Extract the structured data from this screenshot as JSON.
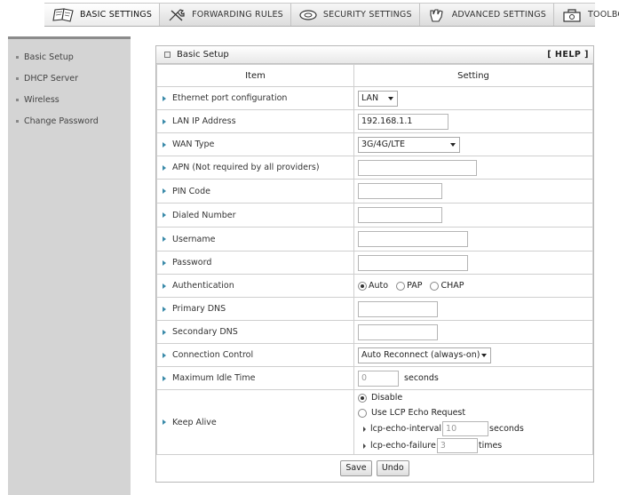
{
  "nav": {
    "tabs": [
      {
        "label": "BASIC SETTINGS",
        "icon": "notebook-icon",
        "active": true
      },
      {
        "label": "FORWARDING RULES",
        "icon": "tools-icon",
        "active": false
      },
      {
        "label": "SECURITY SETTINGS",
        "icon": "disk-icon",
        "active": false
      },
      {
        "label": "ADVANCED SETTINGS",
        "icon": "hand-icon",
        "active": false
      },
      {
        "label": "TOOLBOX",
        "icon": "toolbox-icon",
        "active": false
      }
    ]
  },
  "sidebar": {
    "items": [
      "Basic Setup",
      "DHCP Server",
      "Wireless",
      "Change Password"
    ]
  },
  "panel": {
    "title": "Basic Setup",
    "help": "[ HELP ]",
    "col_item": "Item",
    "col_setting": "Setting"
  },
  "form": {
    "ethernet": {
      "label": "Ethernet port configuration",
      "value": "LAN"
    },
    "lan_ip": {
      "label": "LAN IP Address",
      "value": "192.168.1.1"
    },
    "wan_type": {
      "label": "WAN Type",
      "value": "3G/4G/LTE"
    },
    "apn": {
      "label": "APN (Not required by all providers)",
      "value": ""
    },
    "pin": {
      "label": "PIN Code",
      "value": ""
    },
    "dialed": {
      "label": "Dialed Number",
      "value": ""
    },
    "username": {
      "label": "Username",
      "value": ""
    },
    "password": {
      "label": "Password",
      "value": ""
    },
    "auth": {
      "label": "Authentication",
      "options": [
        "Auto",
        "PAP",
        "CHAP"
      ],
      "selected": "Auto"
    },
    "dns1": {
      "label": "Primary DNS",
      "value": ""
    },
    "dns2": {
      "label": "Secondary DNS",
      "value": ""
    },
    "conn_control": {
      "label": "Connection Control",
      "value": "Auto Reconnect (always-on)"
    },
    "idle": {
      "label": "Maximum Idle Time",
      "value": "0",
      "unit": "seconds"
    },
    "keepalive": {
      "label": "Keep Alive",
      "disable": "Disable",
      "use_lcp": "Use LCP Echo Request",
      "selected": "Disable",
      "interval_label": "lcp-echo-interval",
      "interval_value": "10",
      "interval_unit": "seconds",
      "failure_label": "lcp-echo-failure",
      "failure_value": "3",
      "failure_unit": "times"
    }
  },
  "buttons": {
    "save": "Save",
    "undo": "Undo"
  }
}
